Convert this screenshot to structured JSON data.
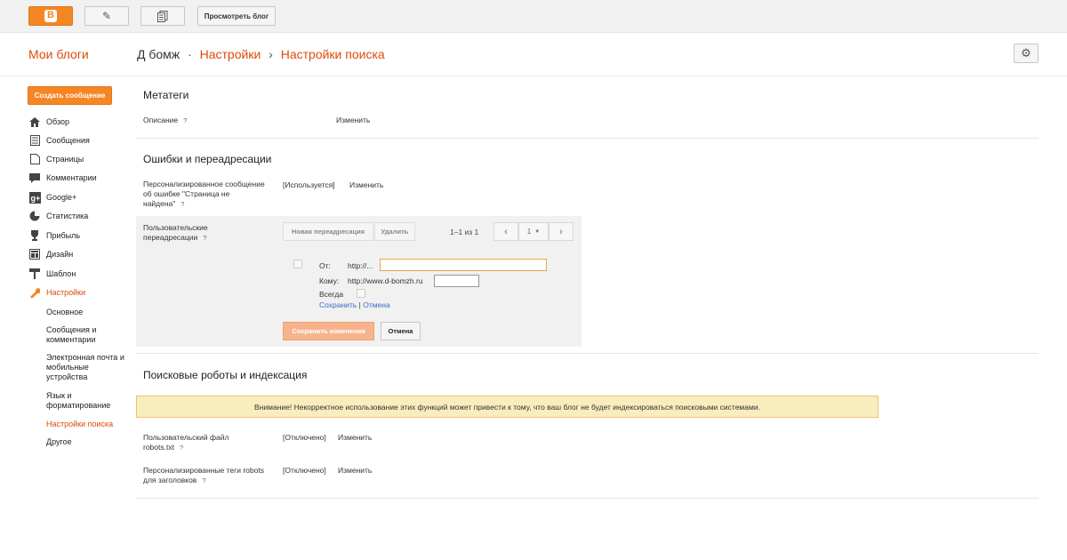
{
  "toolbar": {
    "view_blog_label": "Просмотреть блог",
    "icons": [
      "blogger-logo-icon",
      "pencil-icon",
      "pages-icon"
    ],
    "accent": "#f48624"
  },
  "header": {
    "my_blogs": "Мои блоги",
    "blog_name": "Д бомж",
    "crumb_dot": "·",
    "crumb_settings": "Настройки",
    "crumb_arrow": "›",
    "crumb_search": "Настройки поиска"
  },
  "sidebar": {
    "create_post": "Создать сообщение",
    "items": [
      {
        "label": "Обзор",
        "icon": "home-icon"
      },
      {
        "label": "Сообщения",
        "icon": "posts-icon"
      },
      {
        "label": "Страницы",
        "icon": "pages-icon"
      },
      {
        "label": "Комментарии",
        "icon": "comments-icon"
      },
      {
        "label": "Google+",
        "icon": "google-plus-icon"
      },
      {
        "label": "Статистика",
        "icon": "stats-icon"
      },
      {
        "label": "Прибыль",
        "icon": "trophy-icon"
      },
      {
        "label": "Дизайн",
        "icon": "layout-icon"
      },
      {
        "label": "Шаблон",
        "icon": "template-icon"
      },
      {
        "label": "Настройки",
        "icon": "wrench-icon"
      }
    ],
    "sub_items": [
      "Основное",
      "Сообщения и комментарии",
      "Электронная почта и мобильные устройства",
      "Язык и форматирование",
      "Настройки поиска",
      "Другое"
    ]
  },
  "meta": {
    "title": "Метатеги",
    "description_label": "Описание",
    "help": "?",
    "edit": "Изменить"
  },
  "errors": {
    "title": "Ошибки и переадресации",
    "custom_404_label": "Персонализированное сообщение об ошибке \"Страница не найдена\"",
    "custom_404_status": "[Используется]",
    "edit": "Изменить",
    "redirects_label": "Пользовательские переадресации",
    "new_redirect": "Новая переадресация",
    "delete": "Удалить",
    "pager_info": "1–1 из 1",
    "page_num": "1",
    "from_label": "От:",
    "from_prefix": "http://...",
    "to_label": "Кому:",
    "to_prefix": "http://www.d-bomzh.ru",
    "always_label": "Всегда",
    "save_link": "Сохранить",
    "pipe": "|",
    "cancel_link": "Отмена",
    "save_changes": "Сохранить изменения",
    "cancel": "Отмена"
  },
  "crawlers": {
    "title": "Поисковые роботы и индексация",
    "warning": "Внимание! Некорректное использование этих функций может привести к тому, что ваш блог не будет индексироваться поисковыми системами.",
    "robots_label": "Пользовательский файл robots.txt",
    "robots_status": "[Отключено]",
    "tags_label": "Персонализированные теги robots для заголовков",
    "tags_status": "[Отключено]",
    "edit": "Изменить"
  }
}
